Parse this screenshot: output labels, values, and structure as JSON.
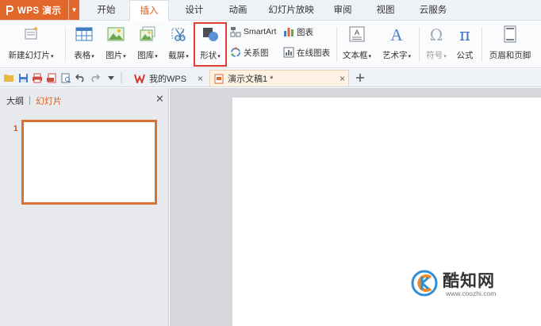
{
  "app": {
    "name": "WPS 演示"
  },
  "menu": {
    "tabs": [
      "开始",
      "插入",
      "设计",
      "动画",
      "幻灯片放映",
      "审阅",
      "视图",
      "云服务"
    ],
    "active_tab": "插入"
  },
  "ribbon": {
    "new_slide": "新建幻灯片",
    "table": "表格",
    "picture": "图片",
    "gallery": "图库",
    "screenshot": "截屏",
    "shape": "形状",
    "smartart": "SmartArt",
    "chart": "图表",
    "relation": "关系图",
    "online_chart": "在线图表",
    "textbox": "文本框",
    "wordart": "艺术字",
    "symbol": "符号",
    "formula": "公式",
    "header_footer": "页眉和页脚"
  },
  "doc_tabs": {
    "wps_tab": "我的WPS",
    "doc_tab": "演示文稿1 *"
  },
  "left_panel": {
    "tab_outline": "大纲",
    "tab_slides": "幻灯片",
    "slide_number": "1"
  },
  "watermark": {
    "name": "酷知网",
    "url": "www.coozhi.com"
  },
  "colors": {
    "accent": "#e2672a",
    "highlight_box": "#e03c31",
    "thumbnail_border": "#d8732f"
  }
}
